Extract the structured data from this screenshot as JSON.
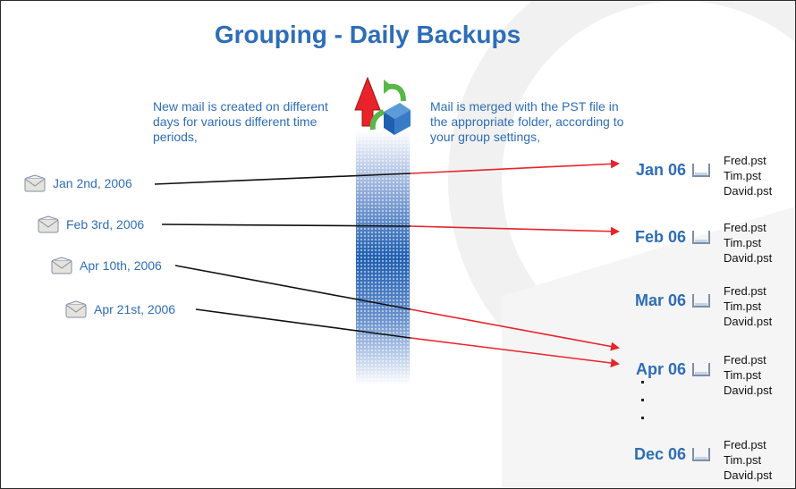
{
  "title": "Grouping - Daily Backups",
  "desc_left": "New mail is created on different days for various different time periods,",
  "desc_right": "Mail is merged with the PST file in the appropriate folder, according to your group settings,",
  "mail_items": [
    {
      "label": "Jan 2nd, 2006"
    },
    {
      "label": "Feb 3rd, 2006"
    },
    {
      "label": "Apr 10th, 2006"
    },
    {
      "label": "Apr 21st, 2006"
    }
  ],
  "months": [
    {
      "label": "Jan 06",
      "files": [
        "Fred.pst",
        "Tim.pst",
        "David.pst"
      ]
    },
    {
      "label": "Feb 06",
      "files": [
        "Fred.pst",
        "Tim.pst",
        "David.pst"
      ]
    },
    {
      "label": "Mar 06",
      "files": [
        "Fred.pst",
        "Tim.pst",
        "David.pst"
      ]
    },
    {
      "label": "Apr 06",
      "files": [
        "Fred.pst",
        "Tim.pst",
        "David.pst"
      ]
    },
    {
      "label": "Dec 06",
      "files": [
        "Fred.pst",
        "Tim.pst",
        "David.pst"
      ]
    }
  ],
  "colors": {
    "accent": "#2e6db8",
    "arrow": "#e8232a",
    "line": "#111111"
  },
  "icons": {
    "mail": "envelope-icon",
    "folder": "tray-icon",
    "merge": "merge-arrows-icon"
  }
}
